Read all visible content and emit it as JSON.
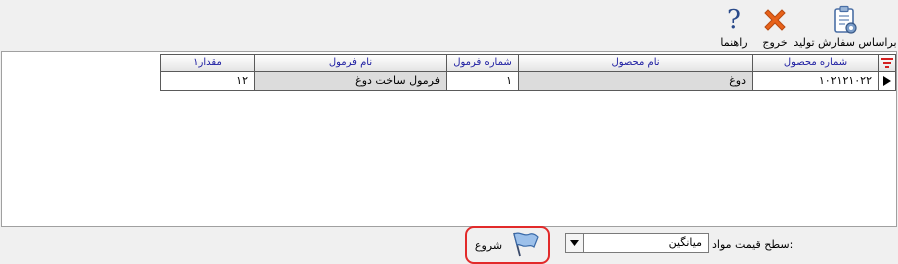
{
  "toolbar": {
    "build_label": "براساس سفارش تولید",
    "exit_label": "خروج",
    "help_label": "راهنما",
    "help_glyph": "?"
  },
  "grid": {
    "columns": [
      {
        "key": "amount",
        "label": "مقدار۱"
      },
      {
        "key": "formula_name",
        "label": "نام فرمول"
      },
      {
        "key": "formula_no",
        "label": "شماره فرمول"
      },
      {
        "key": "product_name",
        "label": "نام محصول"
      },
      {
        "key": "product_no",
        "label": "شماره محصول"
      }
    ],
    "rows": [
      {
        "amount": "۱۲",
        "formula_name": "فرمول ساخت دوغ",
        "formula_no": "۱",
        "product_name": "دوغ",
        "product_no": "۱۰۲۱۲۱۰۲۲"
      }
    ]
  },
  "bottom": {
    "price_level_label": "سطح قیمت مواد:",
    "price_level_value": "میانگین",
    "start_label": "شروع"
  },
  "icons": {
    "build": "clipboard-gear-icon",
    "exit": "red-x-icon",
    "help": "question-mark-icon",
    "filter": "filter-icon",
    "row_indicator": "row-pointer-icon",
    "dropdown": "chevron-down-icon",
    "start": "flag-icon"
  },
  "colors": {
    "header_text": "#1a1aa0",
    "exit_icon": "#e8621a",
    "start_border": "#e22a2a",
    "filter_icon": "#d42020",
    "grey_cell": "#dcdcdc"
  }
}
